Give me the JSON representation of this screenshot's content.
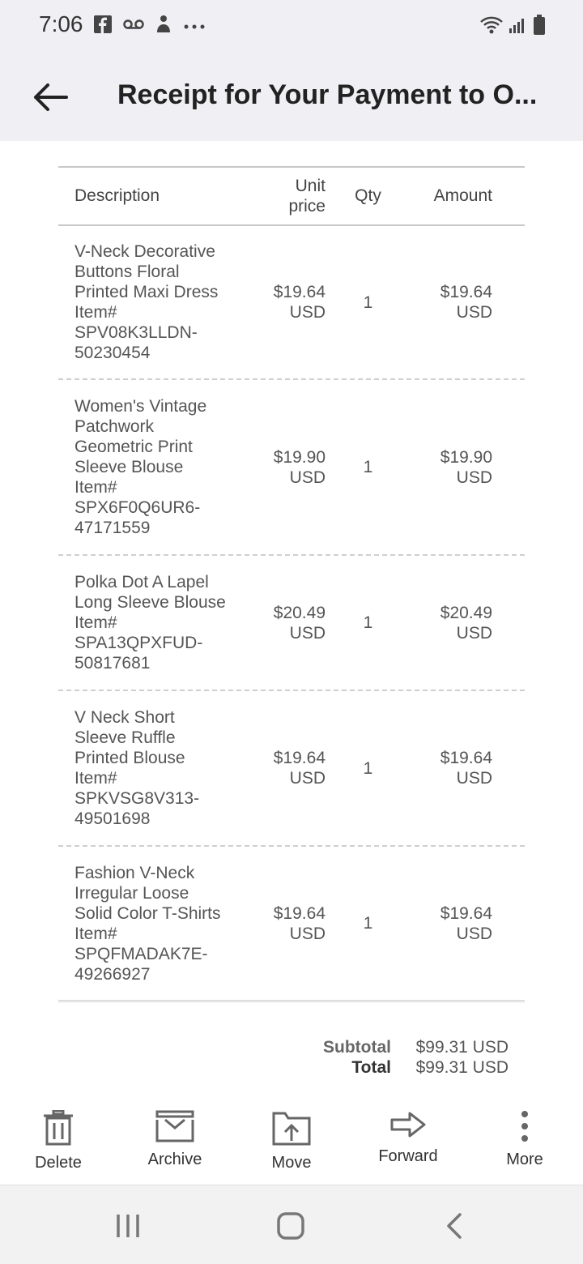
{
  "status_bar": {
    "time": "7:06",
    "left_icons": [
      "facebook-icon",
      "voicemail-icon",
      "person-icon",
      "more-dots-icon"
    ],
    "right_icons": [
      "wifi-icon",
      "signal-icon",
      "battery-icon"
    ]
  },
  "header": {
    "title": "Receipt for Your Payment to O..."
  },
  "table": {
    "headers": {
      "description": "Description",
      "unit_price_1": "Unit",
      "unit_price_2": "price",
      "qty": "Qty",
      "amount": "Amount"
    },
    "rows": [
      {
        "desc": [
          "V-Neck Decorative",
          "Buttons Floral",
          "Printed Maxi Dress",
          "Item#",
          "SPV08K3LLDN-",
          "50230454"
        ],
        "unit_price": [
          "$19.64",
          "USD"
        ],
        "qty": "1",
        "amount": [
          "$19.64",
          "USD"
        ]
      },
      {
        "desc": [
          "Women's Vintage",
          "Patchwork",
          "Geometric Print",
          "Sleeve Blouse",
          "Item#",
          "SPX6F0Q6UR6-",
          "47171559"
        ],
        "unit_price": [
          "$19.90",
          "USD"
        ],
        "qty": "1",
        "amount": [
          "$19.90",
          "USD"
        ]
      },
      {
        "desc": [
          "Polka Dot A Lapel",
          "Long Sleeve Blouse",
          "Item#",
          "SPA13QPXFUD-",
          "50817681"
        ],
        "unit_price": [
          "$20.49",
          "USD"
        ],
        "qty": "1",
        "amount": [
          "$20.49",
          "USD"
        ]
      },
      {
        "desc": [
          "V Neck Short",
          "Sleeve Ruffle",
          "Printed Blouse",
          "Item#",
          "SPKVSG8V313-",
          "49501698"
        ],
        "unit_price": [
          "$19.64",
          "USD"
        ],
        "qty": "1",
        "amount": [
          "$19.64",
          "USD"
        ]
      },
      {
        "desc": [
          "Fashion V-Neck",
          "Irregular Loose",
          "Solid Color T-Shirts",
          "Item#",
          "SPQFMADAK7E-",
          "49266927"
        ],
        "unit_price": [
          "$19.64",
          "USD"
        ],
        "qty": "1",
        "amount": [
          "$19.64",
          "USD"
        ]
      }
    ]
  },
  "totals": {
    "subtotal_label": "Subtotal",
    "subtotal_value": "$99.31 USD",
    "total_label": "Total",
    "total_value": "$99.31 USD"
  },
  "actions": {
    "delete": "Delete",
    "archive": "Archive",
    "move": "Move",
    "forward": "Forward",
    "more": "More"
  }
}
